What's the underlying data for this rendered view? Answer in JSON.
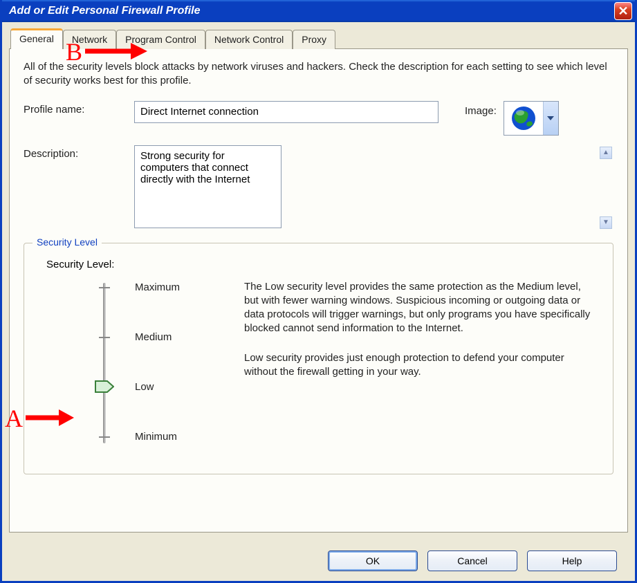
{
  "window": {
    "title": "Add or Edit Personal Firewall Profile"
  },
  "tabs": {
    "general": "General",
    "network": "Network",
    "program_control": "Program Control",
    "network_control": "Network Control",
    "proxy": "Proxy"
  },
  "intro": "All of the security levels block attacks by network viruses and hackers. Check the description for each setting to see which level of security works best for this profile.",
  "profile": {
    "label": "Profile name:",
    "value": "Direct Internet connection",
    "image_label": "Image:"
  },
  "description": {
    "label": "Description:",
    "value": "Strong security for computers that connect directly with the Internet"
  },
  "security": {
    "legend": "Security Level",
    "label": "Security Level:",
    "levels": {
      "max": "Maximum",
      "med": "Medium",
      "low": "Low",
      "min": "Minimum"
    },
    "desc1": "The Low security level provides the same protection as the Medium level, but with fewer warning windows. Suspicious incoming or outgoing data or data protocols will trigger warnings, but only programs you have specifically blocked cannot send information to the Internet.",
    "desc2": "Low security provides just enough protection to defend your computer without the firewall getting in your way."
  },
  "buttons": {
    "ok": "OK",
    "cancel": "Cancel",
    "help": "Help"
  },
  "annotations": {
    "a": "A",
    "b": "B"
  }
}
